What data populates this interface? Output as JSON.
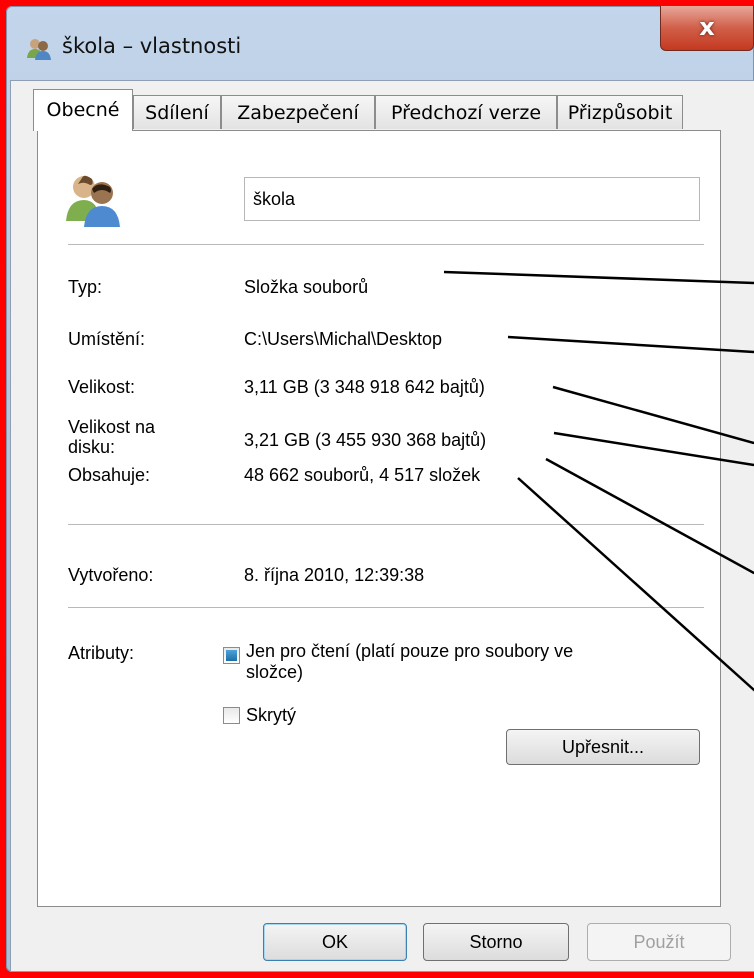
{
  "window": {
    "title": "škola – vlastnosti",
    "close_label": "x"
  },
  "tabs": [
    {
      "label": "Obecné",
      "active": true
    },
    {
      "label": "Sdílení"
    },
    {
      "label": "Zabezpečení"
    },
    {
      "label": "Předchozí verze"
    },
    {
      "label": "Přizpůsobit"
    }
  ],
  "general": {
    "folder_name": "škola",
    "rows": {
      "type": {
        "label": "Typ:",
        "value": "Složka souborů"
      },
      "location": {
        "label": "Umístění:",
        "value": "C:\\Users\\Michal\\Desktop"
      },
      "size": {
        "label": "Velikost:",
        "value": "3,11 GB (3 348 918 642 bajtů)"
      },
      "size_on_disk": {
        "label_line1": "Velikost na",
        "label_line2": "disku:",
        "value": "3,21 GB (3 455 930 368 bajtů)"
      },
      "contains": {
        "label": "Obsahuje:",
        "value": "48 662 souborů, 4 517 složek"
      },
      "created": {
        "label": "Vytvořeno:",
        "value": "8. října 2010, 12:39:38"
      }
    },
    "attributes": {
      "label": "Atributy:",
      "readonly_line1": "Jen pro čtení (platí pouze pro soubory ve",
      "readonly_line2": "složce)",
      "readonly_state": "indeterminate",
      "hidden_label": "Skrytý",
      "hidden_checked": false,
      "advanced_button": "Upřesnit..."
    }
  },
  "footer": {
    "ok": "OK",
    "cancel": "Storno",
    "apply": "Použít"
  },
  "colors": {
    "annotation_border": "#ff0000",
    "arrows": "#000000"
  }
}
